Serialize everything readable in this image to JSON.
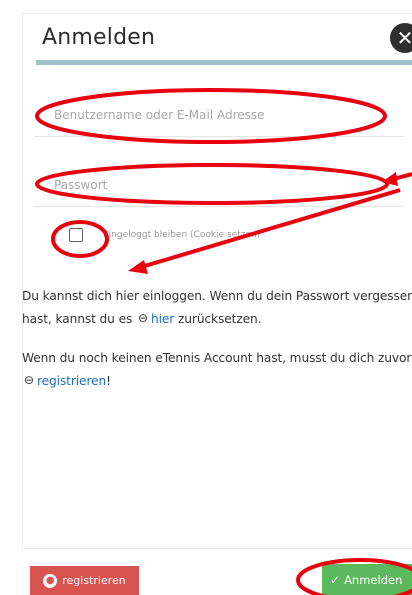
{
  "dialog": {
    "title": "Anmelden",
    "close_icon": "close-icon"
  },
  "form": {
    "username_placeholder": "Benutzername oder E-Mail Adresse",
    "password_placeholder": "Passwort",
    "remember_label": "Eingeloggt bleiben (Cookie setzen)",
    "remember_checked": false
  },
  "info": {
    "paragraph1_before": "Du kannst dich hier einloggen. Wenn du dein Passwort vergessen hast, kannst du es",
    "paragraph1_link": "hier",
    "paragraph1_after": "zurücksetzen.",
    "paragraph2_before": "Wenn du noch keinen eTennis Account hast, musst du dich zuvor",
    "paragraph2_link": "registrieren",
    "paragraph2_after": "!",
    "link_icon": "link-icon"
  },
  "footer": {
    "register_label": "registrieren",
    "register_icon": "user-circle-icon",
    "login_label": "Anmelden",
    "login_icon": "check-icon"
  },
  "colors": {
    "accent_rule": "#9ec4c9",
    "link": "#1f6fb7",
    "register_button": "#d9534f",
    "login_button": "#5cb85c",
    "annotation": "#e8000f"
  }
}
